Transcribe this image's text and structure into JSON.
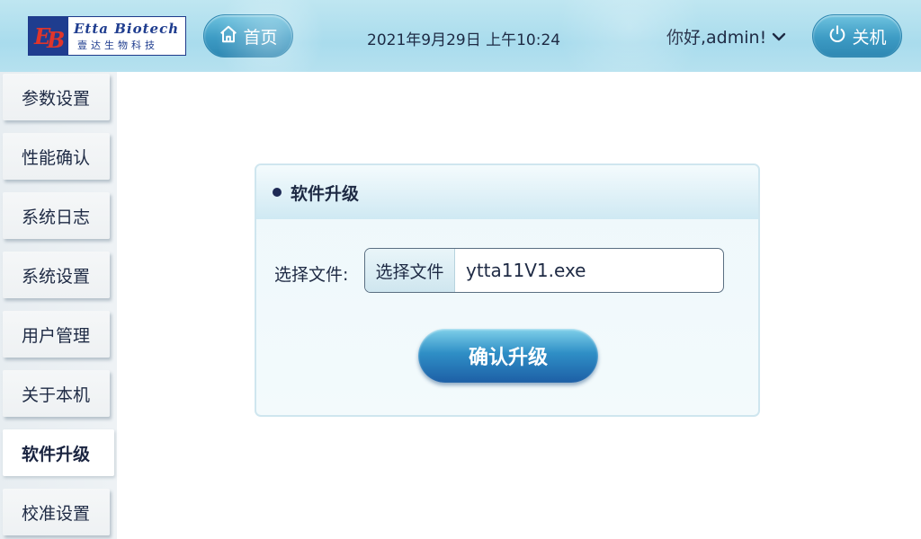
{
  "header": {
    "logo": {
      "en": "Etta Biotech",
      "cn": "壹达生物科技",
      "mark": "EB"
    },
    "home_label": "首页",
    "datetime": "2021年9月29日  上午10:24",
    "greeting": "你好,admin!",
    "power_label": "关机"
  },
  "sidebar": {
    "items": [
      {
        "label": "参数设置"
      },
      {
        "label": "性能确认"
      },
      {
        "label": "系统日志"
      },
      {
        "label": "系统设置"
      },
      {
        "label": "用户管理"
      },
      {
        "label": "关于本机"
      },
      {
        "label": "软件升级"
      },
      {
        "label": "校准设置"
      }
    ],
    "active": "软件升级"
  },
  "panel": {
    "title": "软件升级",
    "file_label": "选择文件:",
    "choose_label": "选择文件",
    "file_name": "ytta11V1.exe",
    "confirm_label": "确认升级"
  },
  "colors": {
    "header_bg": "#a9dced",
    "button_blue": "#3d9bc4",
    "confirm_blue": "#2f8fc6",
    "brand_navy": "#1f3d8f"
  },
  "icons": {
    "home": "home-icon",
    "power": "power-icon",
    "dropdown": "chevron-down-icon"
  }
}
